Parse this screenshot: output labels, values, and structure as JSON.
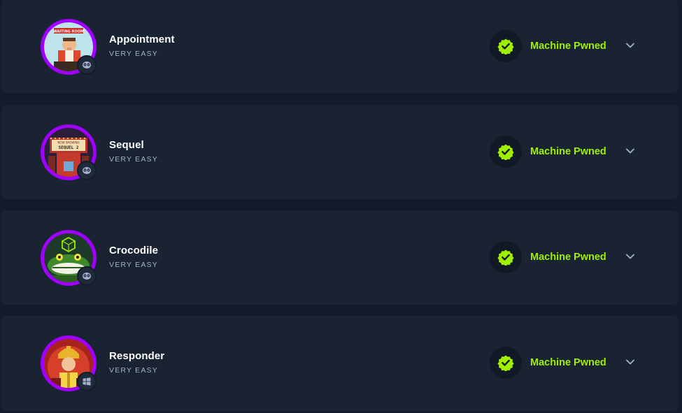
{
  "machines": [
    {
      "name": "Appointment",
      "difficulty": "VERY EASY",
      "status": "Machine Pwned",
      "os": "linux"
    },
    {
      "name": "Sequel",
      "difficulty": "VERY EASY",
      "status": "Machine Pwned",
      "os": "linux"
    },
    {
      "name": "Crocodile",
      "difficulty": "VERY EASY",
      "status": "Machine Pwned",
      "os": "linux"
    },
    {
      "name": "Responder",
      "difficulty": "VERY EASY",
      "status": "Machine Pwned",
      "os": "windows"
    }
  ],
  "avatar_sign": {
    "appointment": "WAITING ROOM",
    "sequel_top": "NOW SHOWING",
    "sequel_marquee": "SEQUEL 2"
  },
  "icons": {
    "status": "check-badge-icon",
    "expand": "chevron-down-icon",
    "os_linux": "linux-penguin-icon",
    "os_windows": "windows-logo-icon"
  },
  "colors": {
    "background": "#141c2b",
    "card": "#1a2332",
    "accent_green": "#9fef00",
    "ring_purple": "#9f00ff",
    "muted_text": "#a4b1cd"
  }
}
